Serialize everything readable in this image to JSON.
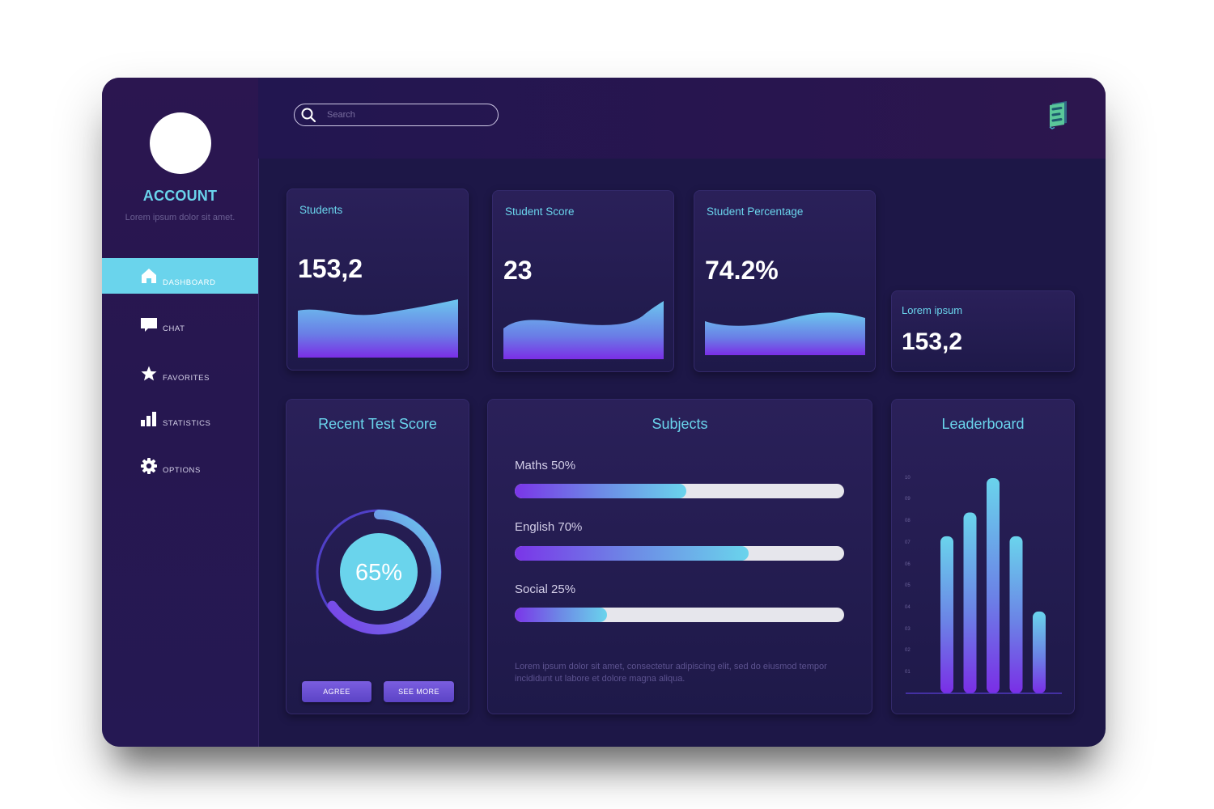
{
  "sidebar": {
    "account_title": "ACCOUNT",
    "account_subtitle": "Lorem ipsum dolor sit amet.",
    "items": [
      {
        "label": "DASHBOARD",
        "icon": "home-icon",
        "active": true
      },
      {
        "label": "CHAT",
        "icon": "chat-icon",
        "active": false
      },
      {
        "label": "FAVORITES",
        "icon": "star-icon",
        "active": false
      },
      {
        "label": "STATISTICS",
        "icon": "bar-chart-icon",
        "active": false
      },
      {
        "label": "OPTIONS",
        "icon": "gear-icon",
        "active": false
      }
    ]
  },
  "search": {
    "placeholder": "Search"
  },
  "stats": [
    {
      "label": "Students",
      "value": "153,2"
    },
    {
      "label": "Student Score",
      "value": "23"
    },
    {
      "label": "Student Percentage",
      "value": "74.2%"
    },
    {
      "label": "Lorem ipsum",
      "value": "153,2"
    }
  ],
  "recent_test": {
    "title": "Recent Test Score",
    "value_label": "65%",
    "percent": 65,
    "agree_label": "AGREE",
    "see_more_label": "SEE MORE"
  },
  "subjects": {
    "title": "Subjects",
    "items": [
      {
        "label": "Maths 50%",
        "percent": 52
      },
      {
        "label": "English  70%",
        "percent": 71
      },
      {
        "label": "Social 25%",
        "percent": 28
      }
    ],
    "note": "Lorem ipsum dolor sit amet, consectetur adipiscing elit, sed do eiusmod tempor incididunt ut labore et dolore magna aliqua."
  },
  "leaderboard": {
    "title": "Leaderboard"
  },
  "chart_data": {
    "type": "bar",
    "title": "Leaderboard",
    "yticks": [
      "01",
      "02",
      "03",
      "04",
      "05",
      "06",
      "07",
      "08",
      "09",
      "10"
    ],
    "ylim": [
      0,
      10
    ],
    "values": [
      7.3,
      8.4,
      10,
      7.3,
      3.8
    ],
    "grid": false
  },
  "colors": {
    "accent": "#6ad4ec",
    "purple": "#7a35e8",
    "background": "#1d1747",
    "sidebar": "#261750"
  }
}
